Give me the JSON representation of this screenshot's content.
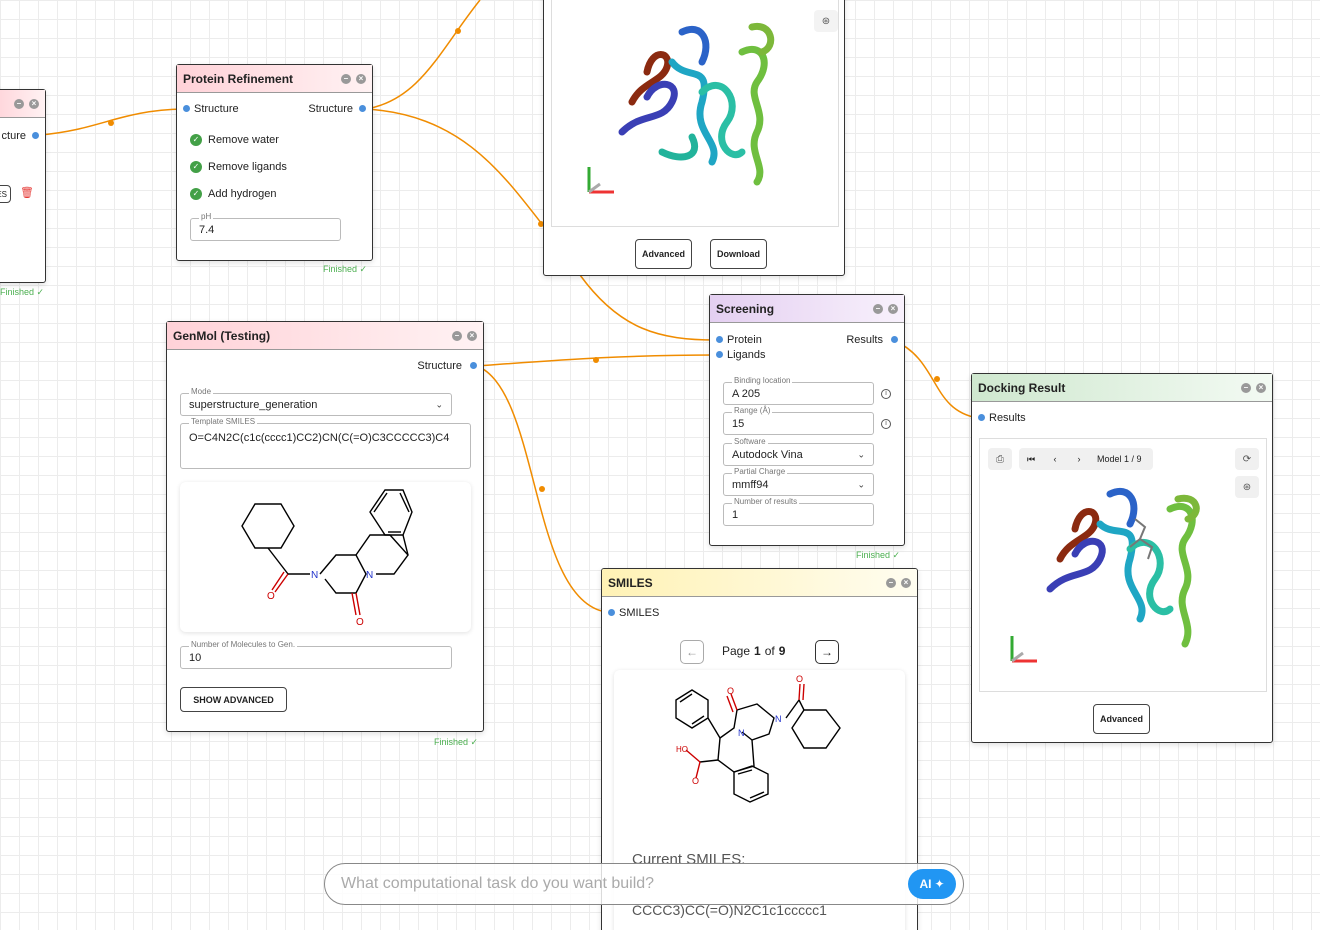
{
  "colors": {
    "edge": "#f08c00",
    "port": "#4a8fdc",
    "finished": "#4caf50",
    "ai": "#2196f3"
  },
  "partial_node": {
    "port_label": "cture",
    "badge": "ES",
    "status": "Finished ✓"
  },
  "protein_refinement": {
    "title": "Protein Refinement",
    "input_label": "Structure",
    "output_label": "Structure",
    "checks": [
      "Remove water",
      "Remove ligands",
      "Add hydrogen"
    ],
    "ph_label": "pH",
    "ph_value": "7.4",
    "status": "Finished ✓"
  },
  "structure_viewer": {
    "advanced_label": "Advanced",
    "download_label": "Download"
  },
  "genmol": {
    "title": "GenMol (Testing)",
    "output_label": "Structure",
    "mode_label": "Mode",
    "mode_value": "superstructure_generation",
    "template_label": "Template SMILES",
    "template_value": "O=C4N2C(c1c(cccc1)CC2)CN(C(=O)C3CCCCC3)C4",
    "num_label": "Number of Molecules to Gen.",
    "num_value": "10",
    "show_advanced_label": "SHOW ADVANCED",
    "status": "Finished ✓"
  },
  "screening": {
    "title": "Screening",
    "inputs": [
      "Protein",
      "Ligands"
    ],
    "output_label": "Results",
    "binding_label": "Binding location",
    "binding_value": "A 205",
    "range_label": "Range (Å)",
    "range_value": "15",
    "software_label": "Software",
    "software_value": "Autodock Vina",
    "charge_label": "Partial Charge",
    "charge_value": "mmff94",
    "results_label": "Number of results",
    "results_value": "1",
    "status": "Finished ✓"
  },
  "docking": {
    "title": "Docking Result",
    "input_label": "Results",
    "model_text": "Model 1 / 9",
    "advanced_label": "Advanced"
  },
  "smiles": {
    "title": "SMILES",
    "input_label": "SMILES",
    "page_prefix": "Page",
    "page_current": "1",
    "page_of": "of",
    "page_total": "9",
    "current_label": "Current SMILES:",
    "current_tail": "CCCC3)CC(=O)N2C1c1ccccc1"
  },
  "ai": {
    "placeholder": "What computational task do you want build?",
    "button_label": "AI"
  }
}
